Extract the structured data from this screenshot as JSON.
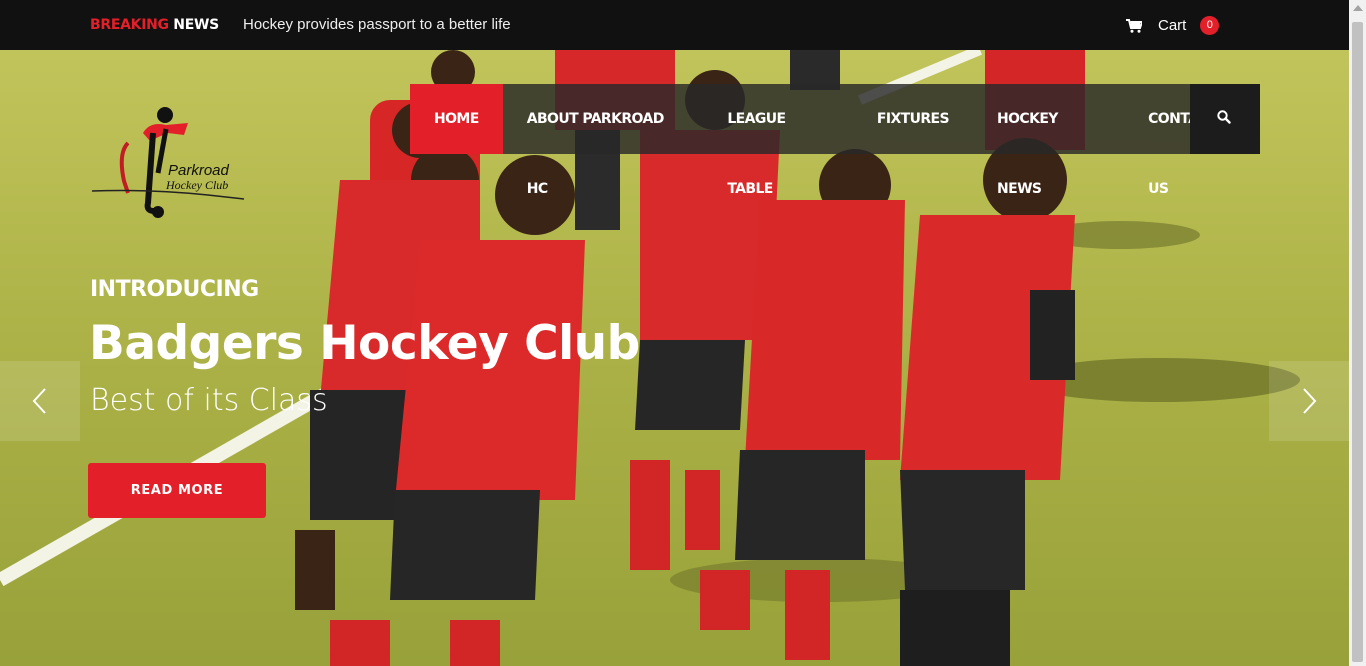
{
  "topbar": {
    "breaking_red": "BREAKING",
    "breaking_white": "NEWS",
    "ticker_text": "Hockey provides passport to a better life",
    "cart_label": "Cart",
    "cart_count": "0"
  },
  "nav": {
    "items": [
      {
        "label": "HOME",
        "active": true
      },
      {
        "label": "ABOUT PARKROAD HC"
      },
      {
        "label": "LEAGUE TABLE"
      },
      {
        "label": "FIXTURES"
      },
      {
        "label": "HOCKEY NEWS"
      },
      {
        "label": "CONTACT US"
      }
    ],
    "search_icon": "search-icon"
  },
  "logo": {
    "line1": "Parkroad",
    "line2": "Hockey Club"
  },
  "slide": {
    "intro": "INTRODUCING",
    "headline": "Badgers Hockey Club",
    "subline": "Best of its Class",
    "button_label": "READ MORE"
  },
  "colors": {
    "accent": "#e3202a",
    "topbar": "#111111",
    "turf": "#a7b043"
  }
}
